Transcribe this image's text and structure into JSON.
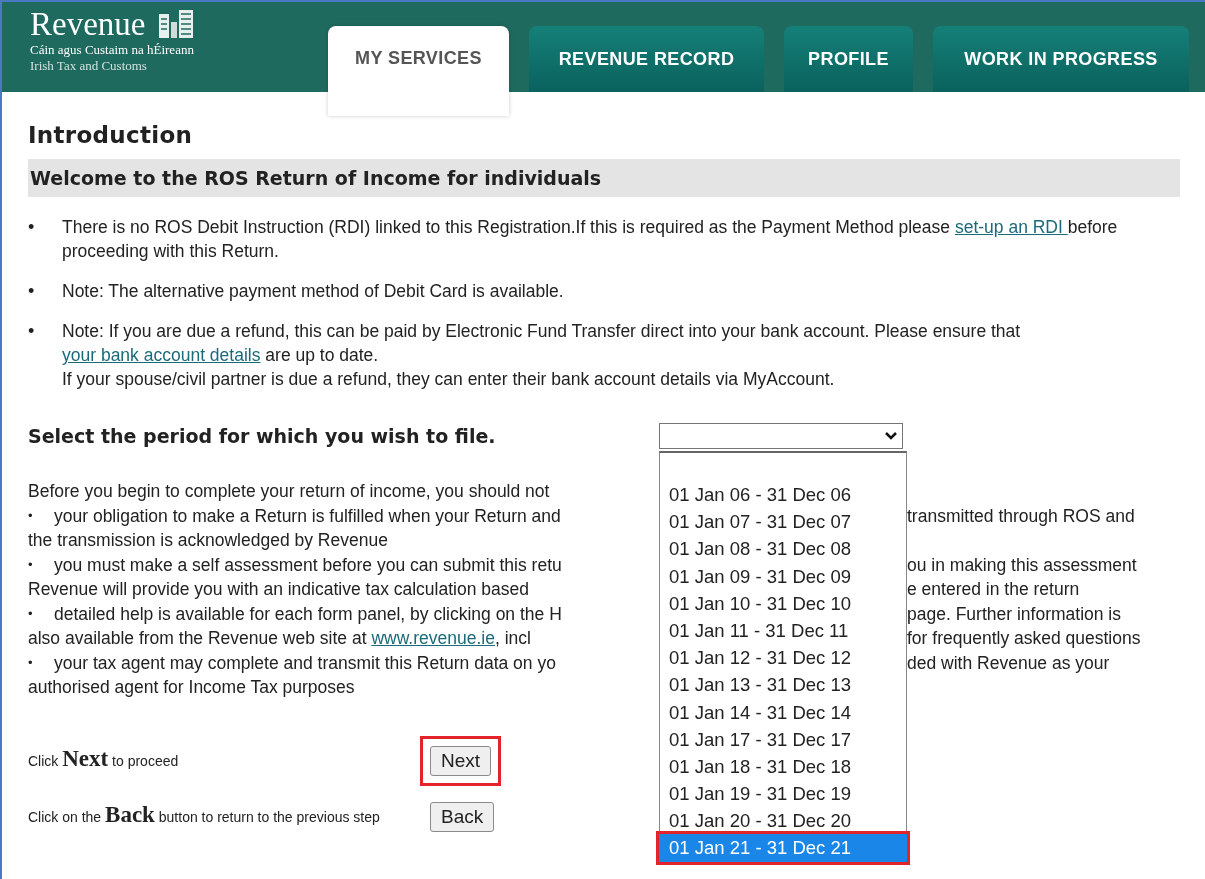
{
  "header": {
    "logo": {
      "name": "Revenue",
      "subtitle_ga": "Cáin agus Custaim na hÉireann",
      "subtitle_en": "Irish Tax and Customs"
    },
    "tabs": [
      {
        "label": "MY SERVICES",
        "selected": true
      },
      {
        "label": "REVENUE RECORD",
        "selected": false
      },
      {
        "label": "PROFILE",
        "selected": false
      },
      {
        "label": "WORK IN PROGRESS",
        "selected": false
      }
    ]
  },
  "heading": "Introduction",
  "banner": "Welcome to the ROS Return of Income for individuals",
  "notes": [
    {
      "bullet": "•",
      "segments": [
        {
          "kind": "text",
          "text": "There is no ROS Debit Instruction (RDI) linked to this Registration.If this is required as the Payment Method please "
        },
        {
          "kind": "link",
          "text": "set-up an RDI "
        },
        {
          "kind": "text",
          "text": " before proceeding with this Return."
        }
      ]
    },
    {
      "bullet": "•",
      "segments": [
        {
          "kind": "text",
          "text": "Note: The alternative payment method of Debit Card is available."
        }
      ]
    },
    {
      "bullet": "•",
      "segments": [
        {
          "kind": "text",
          "text": "Note: If you are due a refund, this can be paid by Electronic Fund Transfer direct into your bank account. Please ensure that "
        },
        {
          "kind": "link",
          "text": "your bank account details"
        },
        {
          "kind": "text",
          "text": " are up to date."
        },
        {
          "kind": "break"
        },
        {
          "kind": "text",
          "text": "If your spouse/civil partner is due a refund, they can enter their bank account details via MyAccount."
        }
      ]
    }
  ],
  "period": {
    "label": "Select the period for which you wish to file.",
    "options": [
      {
        "label": "01 Jan 06 - 31 Dec 06",
        "selected": false
      },
      {
        "label": "01 Jan 07 - 31 Dec 07",
        "selected": false
      },
      {
        "label": "01 Jan 08 - 31 Dec 08",
        "selected": false
      },
      {
        "label": "01 Jan 09 - 31 Dec 09",
        "selected": false
      },
      {
        "label": "01 Jan 10 - 31 Dec 10",
        "selected": false
      },
      {
        "label": "01 Jan 11 - 31 Dec 11",
        "selected": false
      },
      {
        "label": "01 Jan 12 - 31 Dec 12",
        "selected": false
      },
      {
        "label": "01 Jan 13 - 31 Dec 13",
        "selected": false
      },
      {
        "label": "01 Jan 14 - 31 Dec 14",
        "selected": false
      },
      {
        "label": "01 Jan 17 - 31 Dec 17",
        "selected": false
      },
      {
        "label": "01 Jan 18 - 31 Dec 18",
        "selected": false
      },
      {
        "label": "01 Jan 19 - 31 Dec 19",
        "selected": false
      },
      {
        "label": "01 Jan 20 - 31 Dec 20",
        "selected": false
      },
      {
        "label": "01 Jan 21 - 31 Dec 21",
        "selected": true,
        "highlighted": true
      }
    ]
  },
  "info": [
    {
      "left": [
        {
          "kind": "text",
          "text": "Before you begin to complete your return of income, you should not"
        }
      ]
    },
    {
      "bullet": "•",
      "left": [
        {
          "kind": "text",
          "text": "your obligation to make a Return is fulfilled when your Return and"
        }
      ],
      "right": "transmitted through ROS and"
    },
    {
      "left": [
        {
          "kind": "text",
          "text": "the transmission is acknowledged by Revenue"
        }
      ]
    },
    {
      "bullet": "•",
      "left": [
        {
          "kind": "text",
          "text": "you must make a self assessment before you can submit this retu"
        }
      ],
      "right": "ou in making this assessment"
    },
    {
      "left": [
        {
          "kind": "text",
          "text": "Revenue will provide you with an indicative tax calculation based"
        }
      ],
      "right": "e entered in the return"
    },
    {
      "bullet": "•",
      "left": [
        {
          "kind": "text",
          "text": "detailed help is available for each form panel, by clicking on the H"
        }
      ],
      "right": "page. Further information is"
    },
    {
      "left": [
        {
          "kind": "text",
          "text": "also available from the Revenue web site at "
        },
        {
          "kind": "link",
          "text": "www.revenue.ie"
        },
        {
          "kind": "text",
          "text": ", incl"
        }
      ],
      "right": "for frequently asked questions"
    },
    {
      "bullet": "•",
      "left": [
        {
          "kind": "text",
          "text": "your tax agent may complete and transmit this Return data on yo"
        }
      ],
      "right": "ded with Revenue as your"
    },
    {
      "left": [
        {
          "kind": "text",
          "text": "authorised agent for Income Tax purposes"
        }
      ]
    }
  ],
  "actions": [
    {
      "text": "Click **Next** to proceed",
      "button": "Next",
      "highlighted": true
    },
    {
      "text": "Click on the **Back** button to return to the previous step",
      "button": "Back",
      "highlighted": false
    }
  ]
}
